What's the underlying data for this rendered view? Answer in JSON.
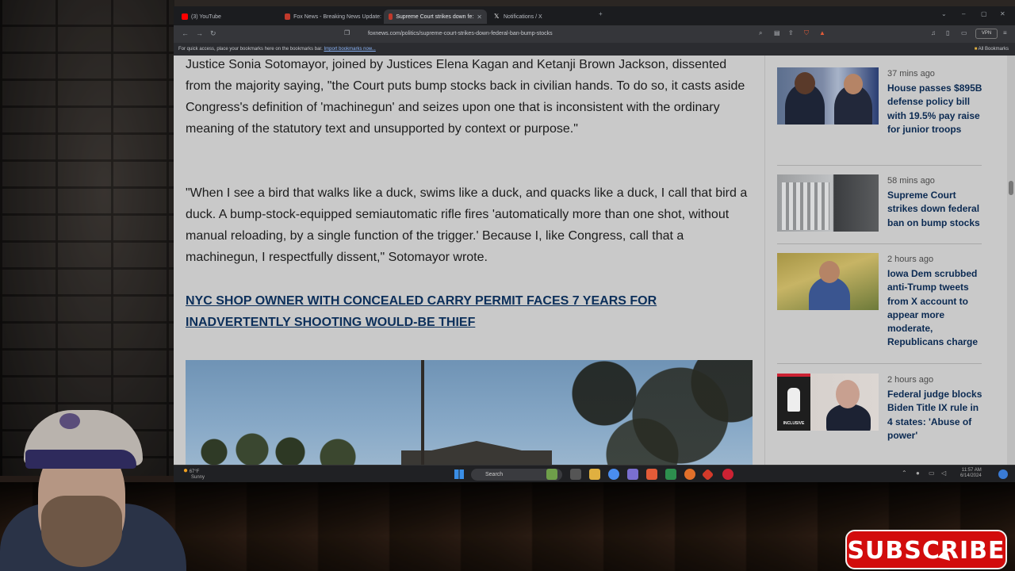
{
  "browser": {
    "tabs": [
      {
        "label": "(3) YouTube",
        "color": "#ff0000"
      },
      {
        "label": "Fox News - Breaking News Update:",
        "color": "#c0392b"
      },
      {
        "label": "Supreme Court strikes down fe:",
        "color": "#c0392b",
        "active": true
      },
      {
        "label": "Notifications / X",
        "color": "#ffffff"
      }
    ],
    "url": "foxnews.com/politics/supreme-court-strikes-down-federal-ban-bump-stocks",
    "vpn_label": "VPN",
    "bookmarks_text": "For quick access, place your bookmarks here on the bookmarks bar.",
    "bookmarks_link": "Import bookmarks now...",
    "all_bookmarks": "All Bookmarks"
  },
  "article": {
    "paragraph1": "Justice Sonia Sotomayor, joined by Justices Elena Kagan and Ketanji Brown Jackson, dissented from the majority saying, \"the Court puts bump stocks back in civilian hands. To do so, it casts aside Congress's definition of 'machinegun' and seizes upon one that is inconsistent with the ordinary meaning of the statutory text and unsupported by context or purpose.\"",
    "paragraph2": "\"When I see a bird that walks like a duck, swims like a duck, and quacks like a duck, I call that bird a duck. A bump-stock-equipped semiautomatic rifle fires 'automatically more than one shot, without manual reloading, by a single function of the trigger.' Because I, like Congress, call that a machinegun, I respectfully dissent,\" Sotomayor wrote.",
    "related_link": "NYC SHOP OWNER WITH CONCEALED CARRY PERMIT FACES 7 YEARS FOR INADVERTENTLY SHOOTING WOULD-BE THIEF"
  },
  "sidebar": {
    "stories": [
      {
        "time": "37 mins ago",
        "headline": "House passes $895B defense policy bill with 19.5% pay raise for junior troops"
      },
      {
        "time": "58 mins ago",
        "headline": "Supreme Court strikes down federal ban on bump stocks"
      },
      {
        "time": "2 hours ago",
        "headline": "Iowa Dem scrubbed anti-Trump tweets from X account to appear more moderate, Republicans charge"
      },
      {
        "time": "2 hours ago",
        "headline": "Federal judge blocks Biden Title IX rule in 4 states: 'Abuse of power'"
      }
    ],
    "thumb4_label": "INCLUSIVE"
  },
  "taskbar": {
    "search_placeholder": "Search",
    "weather_temp": "67°F",
    "weather_desc": "Sunny",
    "clock_time": "11:57 AM",
    "clock_date": "6/14/2024"
  },
  "overlay": {
    "subscribe_label": "SUBSCRIBE"
  }
}
